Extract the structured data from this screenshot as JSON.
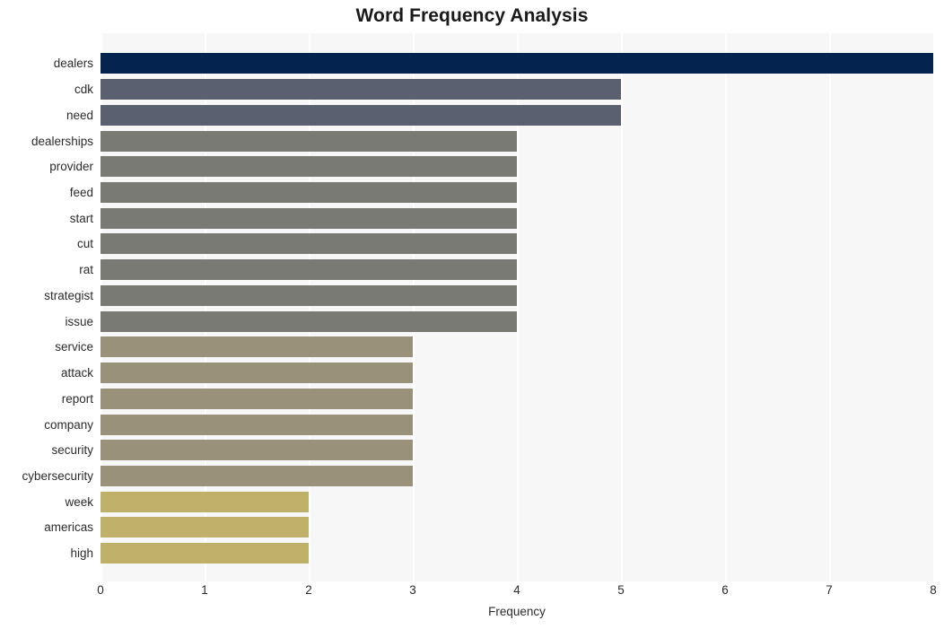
{
  "chart_data": {
    "type": "bar",
    "orientation": "horizontal",
    "title": "Word Frequency Analysis",
    "xlabel": "Frequency",
    "ylabel": "",
    "xlim": [
      0,
      8
    ],
    "xticks": [
      0,
      1,
      2,
      3,
      4,
      5,
      6,
      7,
      8
    ],
    "xtick_labels": [
      "0",
      "1",
      "2",
      "3",
      "4",
      "5",
      "6",
      "7",
      "8"
    ],
    "grid": "vertical",
    "legend": "none",
    "categories": [
      "dealers",
      "cdk",
      "need",
      "dealerships",
      "provider",
      "feed",
      "start",
      "cut",
      "rat",
      "strategist",
      "issue",
      "service",
      "attack",
      "report",
      "company",
      "security",
      "cybersecurity",
      "week",
      "americas",
      "high"
    ],
    "values": [
      8,
      5,
      5,
      4,
      4,
      4,
      4,
      4,
      4,
      4,
      4,
      3,
      3,
      3,
      3,
      3,
      3,
      2,
      2,
      2
    ],
    "bar_colors": [
      "#04244f",
      "#5b6070",
      "#5b6070",
      "#7a7a75",
      "#7a7a75",
      "#7a7a75",
      "#7a7a75",
      "#7a7a75",
      "#7a7a75",
      "#7a7a75",
      "#7a7a75",
      "#99917a",
      "#99917a",
      "#99917a",
      "#99917a",
      "#99917a",
      "#99917a",
      "#bfb169",
      "#bfb169",
      "#bfb169"
    ],
    "plot_background": "#f7f7f7",
    "gridline_color": "#ffffff",
    "figure_background": "#ffffff",
    "text_color": "#2b2b2b"
  }
}
